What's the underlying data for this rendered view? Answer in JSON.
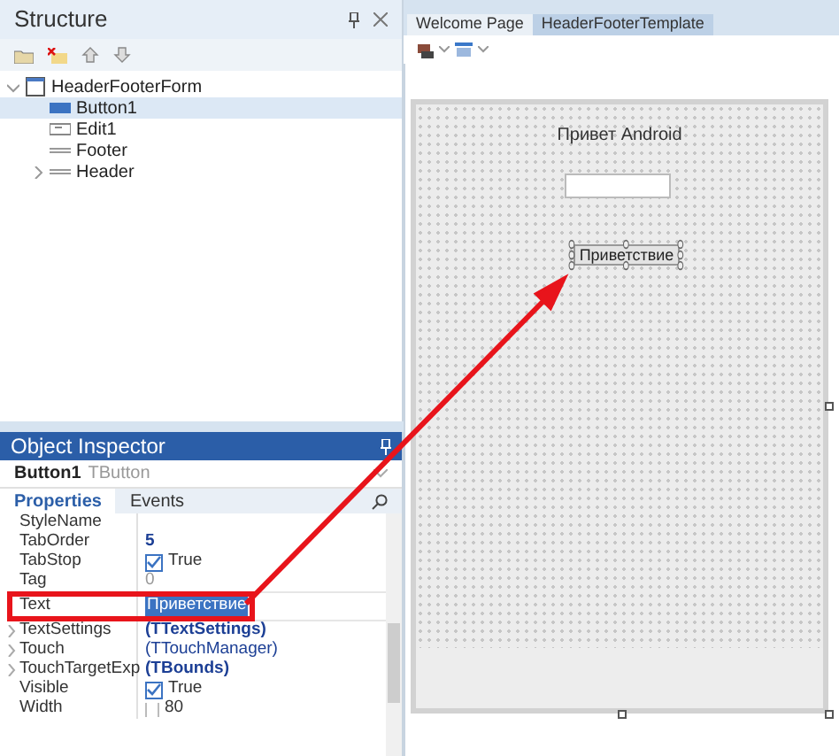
{
  "structure": {
    "title": "Structure",
    "tree": [
      {
        "label": "HeaderFooterForm",
        "kind": "form",
        "selected": false,
        "expandable": true,
        "children": [
          {
            "label": "Button1",
            "kind": "button",
            "selected": true,
            "expandable": false
          },
          {
            "label": "Edit1",
            "kind": "edit",
            "selected": false,
            "expandable": false
          },
          {
            "label": "Footer",
            "kind": "bar",
            "selected": false,
            "expandable": false
          },
          {
            "label": "Header",
            "kind": "bar",
            "selected": false,
            "expandable": true
          }
        ]
      }
    ]
  },
  "inspector": {
    "title": "Object Inspector",
    "component": "Button1",
    "component_type": "TButton",
    "tabs": [
      {
        "label": "Properties",
        "selected": true
      },
      {
        "label": "Events",
        "selected": false
      }
    ],
    "properties": [
      {
        "name": "StyleName",
        "kind": "plain",
        "expandable": false,
        "selected": false
      },
      {
        "name": "TabOrder",
        "value": "5",
        "kind": "bold",
        "expandable": false,
        "selected": false
      },
      {
        "name": "TabStop",
        "value": "True",
        "kind": "check",
        "checked": true,
        "expandable": false,
        "selected": false
      },
      {
        "name": "Tag",
        "value": "0",
        "kind": "plain",
        "expandable": false,
        "selected": false
      },
      {
        "name": "Text",
        "value": "Приветствие",
        "kind": "plain",
        "expandable": false,
        "selected": true
      },
      {
        "name": "TextSettings",
        "value": "(TTextSettings)",
        "kind": "bold",
        "expandable": true,
        "selected": false
      },
      {
        "name": "Touch",
        "value": "(TTouchManager)",
        "kind": "plain",
        "expandable": true,
        "selected": false
      },
      {
        "name": "TouchTargetExp",
        "value": "(TBounds)",
        "kind": "bold",
        "expandable": true,
        "selected": false
      },
      {
        "name": "Visible",
        "value": "True",
        "kind": "check",
        "checked": true,
        "expandable": false,
        "selected": false
      },
      {
        "name": "Width",
        "value": "80",
        "kind": "size",
        "expandable": false,
        "selected": false
      }
    ]
  },
  "editor": {
    "tabs": [
      {
        "label": "Welcome Page",
        "selected": false
      },
      {
        "label": "HeaderFooterTemplate",
        "selected": true
      }
    ],
    "form": {
      "caption": "Привет Android",
      "button": "Приветствие"
    }
  }
}
